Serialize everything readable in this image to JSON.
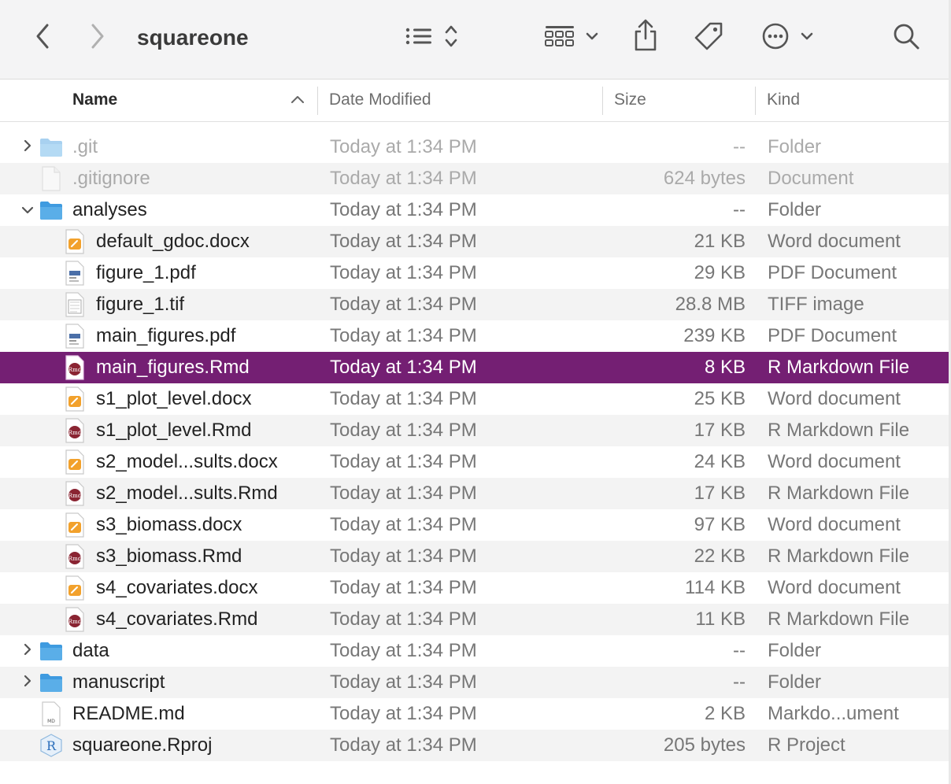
{
  "toolbar": {
    "title": "squareone",
    "back_icon": "chevron-left-icon",
    "forward_icon": "chevron-right-icon",
    "view_icon": "list-view-icon",
    "group_icon": "grid-group-icon",
    "share_icon": "share-icon",
    "tag_icon": "tag-icon",
    "more_icon": "ellipsis-circle-icon",
    "search_icon": "search-icon"
  },
  "columns": {
    "name": "Name",
    "date": "Date Modified",
    "size": "Size",
    "kind": "Kind"
  },
  "colors": {
    "selection": "#741f73",
    "folder": "#5aaee8",
    "word": "#f2a12c",
    "rmd": "#8a2432"
  },
  "rows": [
    {
      "name": ".git",
      "date": "Today at 1:34 PM",
      "size": "--",
      "kind": "Folder",
      "icon": "folder-icon",
      "disclosure": "collapsed"
    },
    {
      "name": ".gitignore",
      "date": "Today at 1:34 PM",
      "size": "624 bytes",
      "kind": "Document",
      "icon": "document-icon",
      "disclosure": ""
    },
    {
      "name": "analyses",
      "date": "Today at 1:34 PM",
      "size": "--",
      "kind": "Folder",
      "icon": "folder-icon",
      "disclosure": "expanded"
    },
    {
      "name": "default_gdoc.docx",
      "date": "Today at 1:34 PM",
      "size": "21 KB",
      "kind": "Word document",
      "icon": "word-doc-icon",
      "disclosure": ""
    },
    {
      "name": "figure_1.pdf",
      "date": "Today at 1:34 PM",
      "size": "29 KB",
      "kind": "PDF Document",
      "icon": "pdf-icon",
      "disclosure": ""
    },
    {
      "name": "figure_1.tif",
      "date": "Today at 1:34 PM",
      "size": "28.8 MB",
      "kind": "TIFF image",
      "icon": "tiff-icon",
      "disclosure": ""
    },
    {
      "name": "main_figures.pdf",
      "date": "Today at 1:34 PM",
      "size": "239 KB",
      "kind": "PDF Document",
      "icon": "pdf-icon",
      "disclosure": ""
    },
    {
      "name": "main_figures.Rmd",
      "date": "Today at 1:34 PM",
      "size": "8 KB",
      "kind": "R Markdown File",
      "icon": "rmd-icon",
      "disclosure": ""
    },
    {
      "name": "s1_plot_level.docx",
      "date": "Today at 1:34 PM",
      "size": "25 KB",
      "kind": "Word document",
      "icon": "word-doc-icon",
      "disclosure": ""
    },
    {
      "name": "s1_plot_level.Rmd",
      "date": "Today at 1:34 PM",
      "size": "17 KB",
      "kind": "R Markdown File",
      "icon": "rmd-icon",
      "disclosure": ""
    },
    {
      "name": "s2_model...sults.docx",
      "date": "Today at 1:34 PM",
      "size": "24 KB",
      "kind": "Word document",
      "icon": "word-doc-icon",
      "disclosure": ""
    },
    {
      "name": "s2_model...sults.Rmd",
      "date": "Today at 1:34 PM",
      "size": "17 KB",
      "kind": "R Markdown File",
      "icon": "rmd-icon",
      "disclosure": ""
    },
    {
      "name": "s3_biomass.docx",
      "date": "Today at 1:34 PM",
      "size": "97 KB",
      "kind": "Word document",
      "icon": "word-doc-icon",
      "disclosure": ""
    },
    {
      "name": "s3_biomass.Rmd",
      "date": "Today at 1:34 PM",
      "size": "22 KB",
      "kind": "R Markdown File",
      "icon": "rmd-icon",
      "disclosure": ""
    },
    {
      "name": "s4_covariates.docx",
      "date": "Today at 1:34 PM",
      "size": "114 KB",
      "kind": "Word document",
      "icon": "word-doc-icon",
      "disclosure": ""
    },
    {
      "name": "s4_covariates.Rmd",
      "date": "Today at 1:34 PM",
      "size": "11 KB",
      "kind": "R Markdown File",
      "icon": "rmd-icon",
      "disclosure": ""
    },
    {
      "name": "data",
      "date": "Today at 1:34 PM",
      "size": "--",
      "kind": "Folder",
      "icon": "folder-icon",
      "disclosure": "collapsed"
    },
    {
      "name": "manuscript",
      "date": "Today at 1:34 PM",
      "size": "--",
      "kind": "Folder",
      "icon": "folder-icon",
      "disclosure": "collapsed"
    },
    {
      "name": "README.md",
      "date": "Today at 1:34 PM",
      "size": "2 KB",
      "kind": "Markdo...ument",
      "icon": "markdown-doc-icon",
      "disclosure": ""
    },
    {
      "name": "squareone.Rproj",
      "date": "Today at 1:34 PM",
      "size": "205 bytes",
      "kind": "R Project",
      "icon": "rproj-icon",
      "disclosure": ""
    }
  ]
}
